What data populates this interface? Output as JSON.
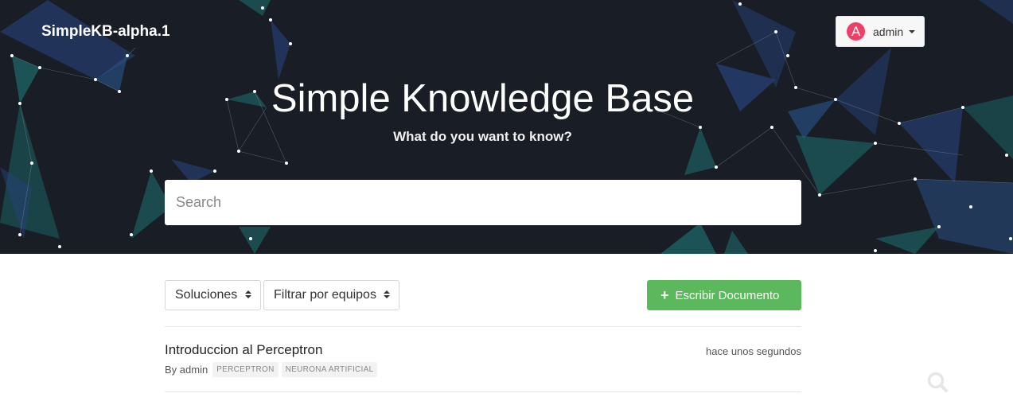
{
  "navbar": {
    "brand": "SimpleKB-alpha.1",
    "user": {
      "initial": "A",
      "name": "admin"
    }
  },
  "hero": {
    "title": "Simple Knowledge Base",
    "subtitle": "What do you want to know?"
  },
  "search": {
    "placeholder": "Search",
    "value": ""
  },
  "filters": {
    "solutions": "Soluciones",
    "teams": "Filtrar por equipos"
  },
  "write_button": "Escribir Documento",
  "documents": [
    {
      "title": "Introduccion al Perceptron",
      "author": "By admin",
      "tags": [
        "PERCEPTRON",
        "NEURONA ARTIFICIAL"
      ],
      "time": "hace unos segundos"
    }
  ],
  "colors": {
    "hero_bg": "#191d25",
    "accent_green": "#5cb85c",
    "avatar": "#ef3f67"
  }
}
